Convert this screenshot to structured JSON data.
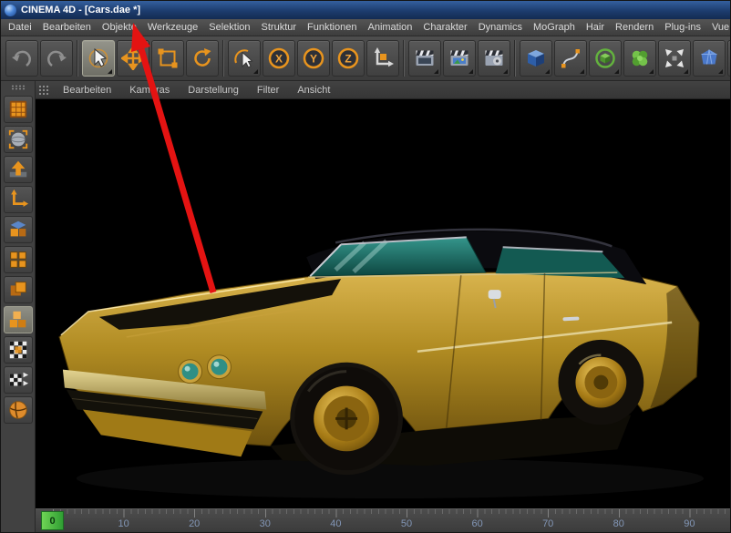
{
  "titlebar": {
    "title": "CINEMA 4D - [Cars.dae *]"
  },
  "menubar": {
    "items": [
      "Datei",
      "Bearbeiten",
      "Objekte",
      "Werkzeuge",
      "Selektion",
      "Struktur",
      "Funktionen",
      "Animation",
      "Charakter",
      "Dynamics",
      "MoGraph",
      "Hair",
      "Rendern",
      "Plug-ins",
      "Vue"
    ]
  },
  "toolbar": {
    "axis_locks": [
      "X",
      "Y",
      "Z"
    ],
    "buttons": [
      "undo",
      "redo",
      "live-selection",
      "move",
      "scale",
      "rotate",
      "last-used-tool",
      "lock-x",
      "lock-y",
      "lock-z",
      "coordinate-system",
      "render-view",
      "render-to-picture-viewer",
      "edit-render-settings",
      "add-cube-primitive",
      "add-spline",
      "add-generator",
      "add-mograph-object",
      "add-deformer",
      "add-scene-object"
    ]
  },
  "viewport_menu": {
    "items": [
      "Bearbeiten",
      "Kameras",
      "Darstellung",
      "Filter",
      "Ansicht"
    ]
  },
  "left_toolbar": {
    "tools": [
      "make-editable",
      "model-mode",
      "texture-mode",
      "object-axis-mode",
      "workplane-mode",
      "points-mode",
      "edges-mode",
      "polygons-mode",
      "texture-paint-mode",
      "uv-edit-mode",
      "simulation-ball"
    ]
  },
  "viewport": {
    "scene_description": "Gold classic coupe with black roof and teal glass rendered on black background"
  },
  "timeline": {
    "ticks": [
      "0",
      "10",
      "20",
      "30",
      "40",
      "50",
      "60",
      "70",
      "80",
      "90"
    ],
    "current_frame": "0"
  },
  "annotation": {
    "shape": "red-arrow",
    "color": "#e41312"
  },
  "colors": {
    "accent_orange": "#e8941e",
    "titlebar_blue": "#24498c",
    "car_gold": "#b08b22",
    "glass_teal": "#2f8f85",
    "marker_green": "#3fae3f",
    "tick_text": "#8296b6"
  }
}
